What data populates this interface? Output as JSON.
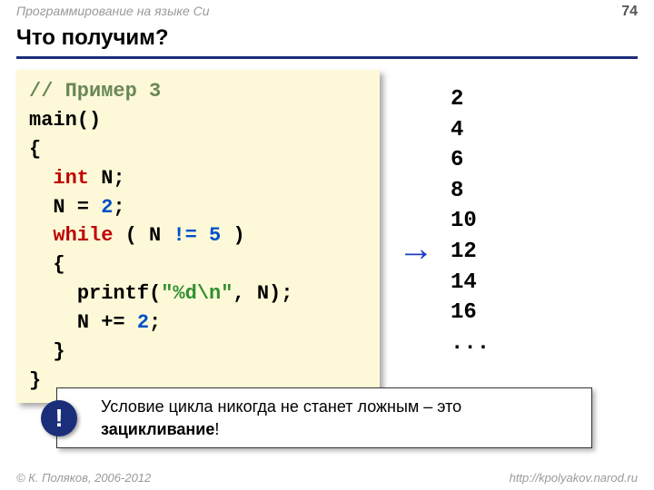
{
  "header": {
    "course": "Программирование на языке Си",
    "page": "74"
  },
  "title": "Что получим?",
  "code": {
    "comment": "// Пример 3",
    "main": "main()",
    "lbrace": "{",
    "decl_kw": "int",
    "decl_rest": " N;",
    "assign_l": "N = ",
    "assign_v": "2",
    "assign_r": ";",
    "while_kw": "while",
    "while_l": " ( N ",
    "while_op": "!=",
    "while_sp": " ",
    "while_v": "5",
    "while_r": " )",
    "lbrace2": "{",
    "printf_l": "printf(",
    "printf_s": "\"%d\\n\"",
    "printf_r": ", N);",
    "inc_l": "N += ",
    "inc_v": "2",
    "inc_r": ";",
    "rbrace2": "}",
    "rbrace": "}"
  },
  "arrow": "→",
  "output": [
    "2",
    "4",
    "6",
    "8",
    "10",
    "12",
    "14",
    "16",
    "..."
  ],
  "warning": {
    "mark": "!",
    "text_prefix": "Условие цикла никогда не станет ложным – это ",
    "text_key": "зацикливание",
    "text_suffix": "!"
  },
  "footer": {
    "left": "© К. Поляков, 2006-2012",
    "right": "http://kpolyakov.narod.ru"
  }
}
